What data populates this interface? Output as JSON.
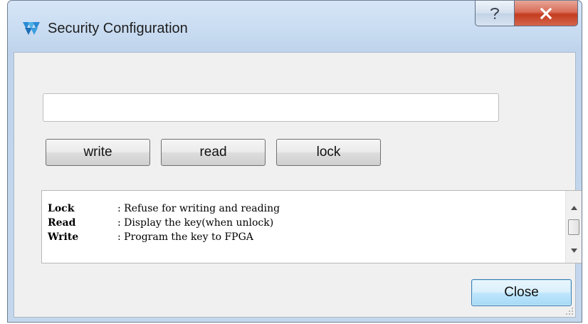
{
  "window": {
    "title": "Security Configuration",
    "app_icon": "gowin-logo-icon",
    "help_glyph": "?",
    "close_glyph": "X"
  },
  "form": {
    "key_value": "",
    "key_placeholder": ""
  },
  "buttons": {
    "write": "write",
    "read": "read",
    "lock": "lock",
    "close": "Close"
  },
  "help": {
    "lines": [
      {
        "term": "Lock",
        "desc": ": Refuse for writing and reading"
      },
      {
        "term": "Read",
        "desc": ": Display the key(when unlock)"
      },
      {
        "term": "Write",
        "desc": ": Program the key to FPGA"
      }
    ]
  },
  "colors": {
    "title_bar": "#c9dcf1",
    "close_button_red": "#c43c1f",
    "default_button_blue": "#bee6fd"
  }
}
